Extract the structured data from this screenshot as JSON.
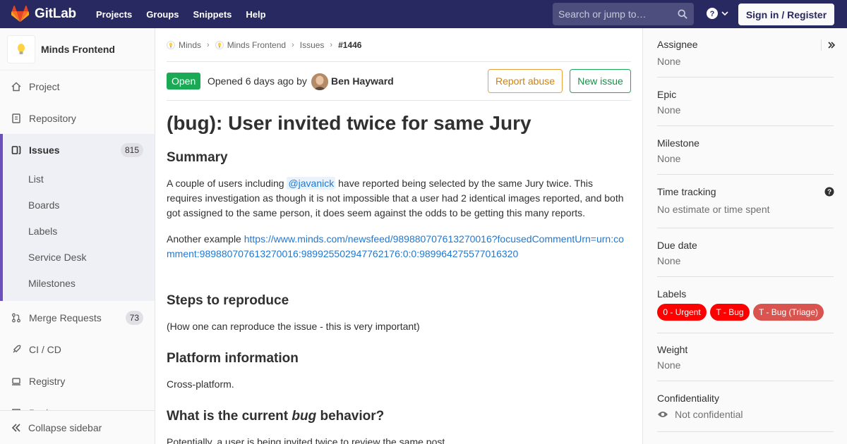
{
  "topbar": {
    "brand": "GitLab",
    "nav": [
      "Projects",
      "Groups",
      "Snippets",
      "Help"
    ],
    "search_placeholder": "Search or jump to…",
    "signin": "Sign in / Register",
    "colors": {
      "bar": "#292961",
      "logo": "#e24329"
    }
  },
  "sidebar": {
    "project_name": "Minds Frontend",
    "items": {
      "project": "Project",
      "repository": "Repository",
      "issues": "Issues",
      "issues_count": "815",
      "merge_requests": "Merge Requests",
      "mr_count": "73",
      "cicd": "CI / CD",
      "registry": "Registry",
      "partial": "Packages"
    },
    "issues_sub": [
      "List",
      "Boards",
      "Labels",
      "Service Desk",
      "Milestones"
    ],
    "collapse": "Collapse sidebar"
  },
  "breadcrumb": [
    "Minds",
    "Minds Frontend",
    "Issues",
    "#1446"
  ],
  "issue": {
    "status": "Open",
    "opened_text": "Opened 6 days ago by",
    "author": "Ben Hayward",
    "report_abuse": "Report abuse",
    "new_issue": "New issue",
    "title": "(bug): User invited twice for same Jury",
    "summary_heading": "Summary",
    "summary_pre": "A couple of users including ",
    "summary_mention": "@javanick",
    "summary_post": " have reported being selected by the same Jury twice. This requires investigation as though it is not impossible that a user had 2 identical images reported, and both got assigned to the same person, it does seem against the odds to be getting this many reports.",
    "example_pre": "Another example ",
    "example_link": "https://www.minds.com/newsfeed/989880707613270016?focusedCommentUrn=urn:comment:989880707613270016:989925502947762176:0:0:989964275577016320",
    "steps_heading": "Steps to reproduce",
    "steps_text": "(How one can reproduce the issue - this is very important)",
    "platform_heading": "Platform information",
    "platform_text": "Cross-platform.",
    "current_heading_pre": "What is the current ",
    "current_heading_em": "bug",
    "current_heading_post": " behavior?",
    "current_text": "Potentially, a user is being invited twice to review the same post."
  },
  "right_sidebar": {
    "assignee_title": "Assignee",
    "assignee_value": "None",
    "epic_title": "Epic",
    "epic_value": "None",
    "milestone_title": "Milestone",
    "milestone_value": "None",
    "time_title": "Time tracking",
    "time_value": "No estimate or time spent",
    "due_title": "Due date",
    "due_value": "None",
    "labels_title": "Labels",
    "labels": [
      {
        "text": "0 - Urgent",
        "color": "#ff0000"
      },
      {
        "text": "T - Bug",
        "color": "#ff0000"
      },
      {
        "text": "T - Bug (Triage)",
        "color": "#d9534f"
      }
    ],
    "weight_title": "Weight",
    "weight_value": "None",
    "conf_title": "Confidentiality",
    "conf_value": "Not confidential"
  }
}
